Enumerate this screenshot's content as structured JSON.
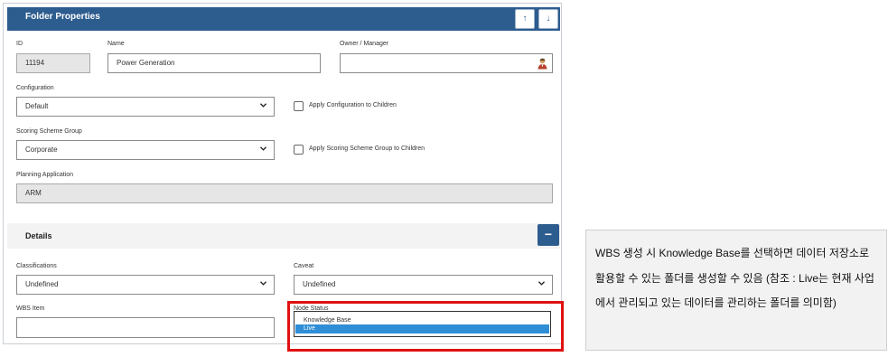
{
  "header": {
    "title": "Folder Properties",
    "up_icon": "↑",
    "down_icon": "↓"
  },
  "form": {
    "id_label": "ID",
    "id_value": "11194",
    "name_label": "Name",
    "name_value": "Power Generation",
    "owner_label": "Owner / Manager",
    "owner_value": "",
    "configuration_label": "Configuration",
    "configuration_value": "Default",
    "apply_configuration_label": "Apply Configuration to Children",
    "scoring_label": "Scoring Scheme Group",
    "scoring_value": "Corporate",
    "apply_scoring_label": "Apply Scoring Scheme Group to Children",
    "planning_label": "Planning Application",
    "planning_value": "ARM"
  },
  "details": {
    "title": "Details",
    "collapse_icon": "−",
    "classifications_label": "Classifications",
    "classifications_value": "Undefined",
    "caveat_label": "Caveat",
    "caveat_value": "Undefined",
    "wbs_item_label": "WBS Item",
    "wbs_item_value": "",
    "node_status_label": "Node Status",
    "node_status_options": [
      "Knowledge Base",
      "Live"
    ],
    "node_status_selected": "Live"
  },
  "annotation": {
    "text": "WBS 생성 시 Knowledge Base를 선택하면 데이터 저장소로 활용할 수 있는 폴더를 생성할 수 있음 (참조 : Live는 현재 사업에서 관리되고 있는 데이터를 관리하는 폴더를 의미함)",
    "highlight_color": "#e01010"
  },
  "colors": {
    "header_bg": "#2d5c8f",
    "selected_option_bg": "#2f8ed6"
  }
}
